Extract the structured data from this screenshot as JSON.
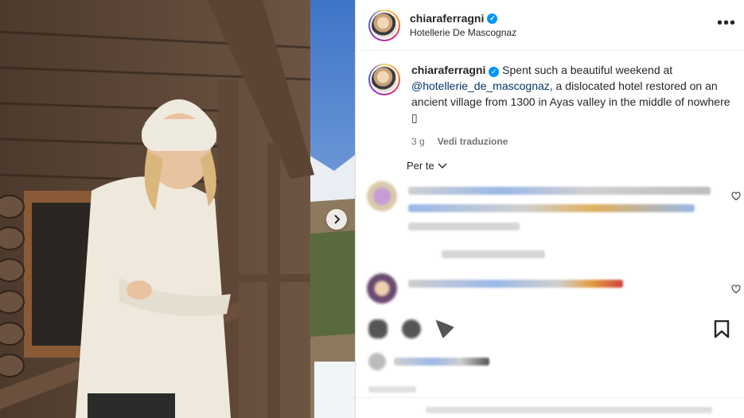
{
  "post": {
    "username": "chiaraferragni",
    "location": "Hotellerie De Mascognaz",
    "more_icon": "more-horizontal-icon"
  },
  "caption": {
    "username": "chiaraferragni",
    "text_before": "Spent such a beautiful weekend at",
    "mention": "@hotellerie_de_mascognaz",
    "text_after": ", a dislocated hotel restored on an ancient village from 1300 in Ayas valley in the middle of nowhere",
    "emoji_placeholder": "▯",
    "time": "3 g",
    "translate_label": "Vedi traduzione"
  },
  "comments": {
    "sort_label": "Per te",
    "sort_icon": "chevron-down-icon",
    "heart_icon": "heart-outline-icon"
  },
  "actions": {
    "icons": [
      "heart-icon",
      "comment-icon",
      "share-icon"
    ],
    "bookmark_icon": "bookmark-icon"
  },
  "media": {
    "next_icon": "chevron-right-icon"
  },
  "colors": {
    "verified": "#0095f6",
    "mention": "#00376b",
    "meta_gray": "#737373"
  }
}
